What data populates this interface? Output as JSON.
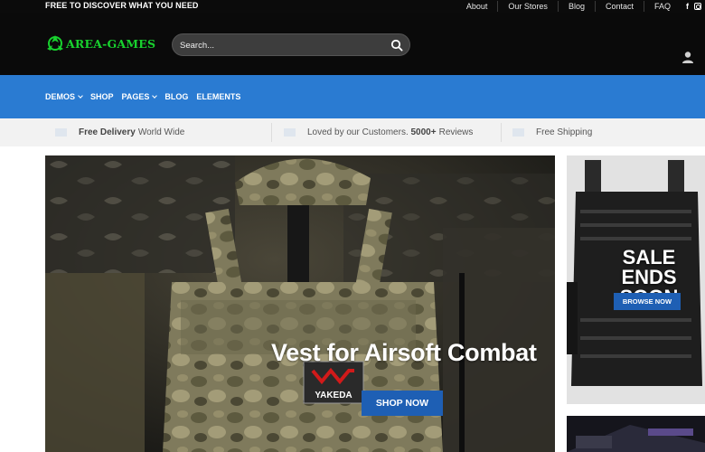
{
  "topbar": {
    "promo": "FREE TO DISCOVER WHAT YOU NEED",
    "links": [
      "About",
      "Our Stores",
      "Blog",
      "Contact",
      "FAQ"
    ],
    "social": {
      "facebook": "f",
      "icons": [
        "facebook-icon",
        "instagram-icon"
      ]
    }
  },
  "header": {
    "logo_text": "AREA-GAMES",
    "search_placeholder": "Search...",
    "colors": {
      "logo": "#18d12e",
      "background": "#0a0a0a"
    }
  },
  "nav": {
    "items": [
      "DEMOS",
      "SHOP",
      "PAGES",
      "BLOG",
      "ELEMENTS"
    ],
    "color": "#2a7bd2"
  },
  "strip": {
    "delivery_bold": "Free Delivery",
    "delivery_rest": "World Wide",
    "reviews_text": "Loved by our Customers.",
    "reviews_bold": "5000+",
    "reviews_rest": "Reviews",
    "shipping": "Free Shipping"
  },
  "hero": {
    "title": "Vest for Airsoft Combat",
    "button": "SHOP NOW",
    "patch_text": "YAKEDA"
  },
  "side_banner": {
    "title": "SALE ENDS SOON",
    "button": "BROWSE NOW"
  }
}
